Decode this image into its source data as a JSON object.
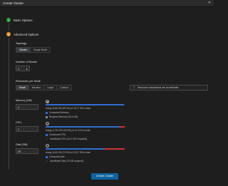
{
  "window": {
    "title": "Create Cluster",
    "close_glyph": "✕"
  },
  "steps": [
    {
      "label": "Basic Options",
      "state": "done",
      "color": "#2ea043"
    },
    {
      "label": "Advanced Options",
      "number": "2",
      "state": "active",
      "color": "#e8912d"
    }
  ],
  "topology": {
    "label": "Topology",
    "options": [
      "Cluster",
      "Single Node"
    ],
    "selected": "Cluster"
  },
  "nodes": {
    "label": "Number of Nodes",
    "value": "3"
  },
  "resources": {
    "label": "Resources per Node",
    "options": [
      "Small",
      "Medium",
      "Large",
      "Custom"
    ],
    "selected": "Small",
    "info": "Resource calculations are an estimate",
    "info_icon": "info-circle-icon"
  },
  "memory": {
    "label": "Memory (GB)",
    "value": "2",
    "usage": "Using 16.68 GB (99.4%) of 16.77 GB in total",
    "used_fraction": 0.994,
    "legend": [
      {
        "text": "Consumed Memory",
        "color": "#2f6fd1"
      },
      {
        "text": "Required Memory (16.6 GB)",
        "color": "#7b8aa3"
      }
    ]
  },
  "cpu": {
    "label": "CPU",
    "value": "1",
    "usage": "Using 11.20 CPU (93.3%) of 12 CPU in total",
    "used_fraction": 0.933,
    "over_fraction": 0.067,
    "legend": [
      {
        "text": "Consumed CPU",
        "color": "#2f6fd1"
      },
      {
        "text": "Insufficient CPU (14.0 CPU required)",
        "warning": true
      }
    ]
  },
  "disk": {
    "label": "Disk (GB)",
    "value": "25",
    "usage": "Using 16.80 GB (73.9%) of 19.37 GB in total",
    "used_fraction": 0.739,
    "over_fraction": 0.261,
    "legend": [
      {
        "text": "Consumed disk",
        "color": "#2f6fd1"
      },
      {
        "text": "Insufficient Disk (75 GB required)",
        "warning": true
      }
    ]
  },
  "actions": {
    "create_label": "Create Cluster"
  },
  "colors": {
    "accent": "#0e639c",
    "bar_fill": "#2f6fd1",
    "bar_over": "#d13438"
  }
}
